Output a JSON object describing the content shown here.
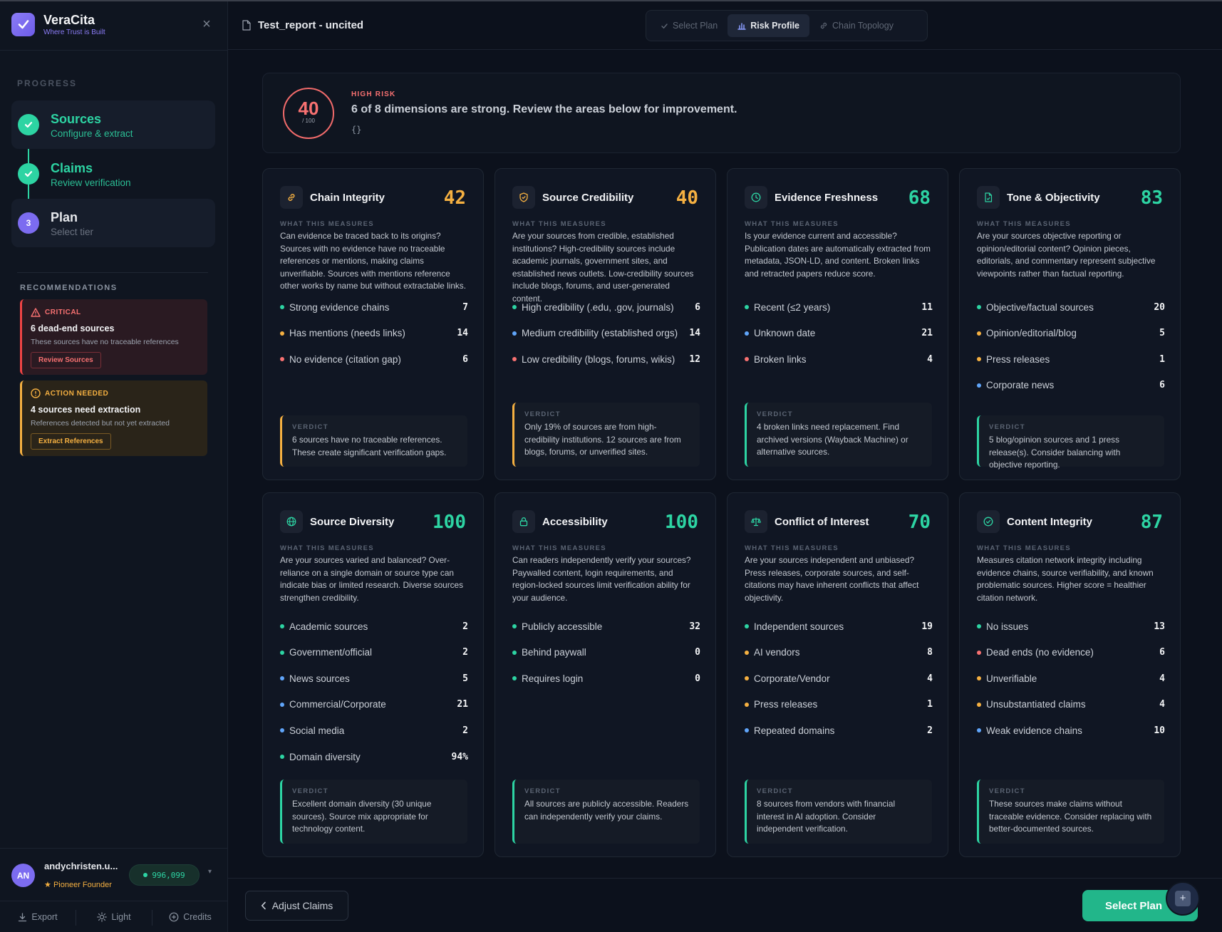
{
  "app": {
    "name": "VeraCita",
    "tagline": "Where Trust is Built"
  },
  "document": {
    "title": "Test_report - uncited"
  },
  "tabs": [
    {
      "label": "Select Plan",
      "icon": "check-icon",
      "active": false
    },
    {
      "label": "Risk Profile",
      "icon": "bar-chart-icon",
      "active": true
    },
    {
      "label": "Chain Topology",
      "icon": "link-icon",
      "active": false
    }
  ],
  "progress": {
    "title": "PROGRESS",
    "steps": [
      {
        "title": "Sources",
        "subtitle": "Configure & extract",
        "status": "done"
      },
      {
        "title": "Claims",
        "subtitle": "Review verification",
        "status": "done"
      },
      {
        "title": "Plan",
        "subtitle": "Select tier",
        "status": "current",
        "number": "3"
      }
    ]
  },
  "recommendations": {
    "title": "RECOMMENDATIONS",
    "items": [
      {
        "level": "CRITICAL",
        "headline": "6 dead-end sources",
        "description": "These sources have no traceable references",
        "action": "Review Sources"
      },
      {
        "level": "ACTION NEEDED",
        "headline": "4 sources need extraction",
        "description": "References detected but not yet extracted",
        "action": "Extract References"
      }
    ]
  },
  "user": {
    "initials": "AN",
    "name": "andychristen.u...",
    "role": "Pioneer Founder",
    "credits": "996,099"
  },
  "footer": {
    "export": "Export",
    "theme": "Light",
    "credits": "Credits"
  },
  "summary": {
    "score": "40",
    "score_max": "/ 100",
    "risk_label": "HIGH RISK",
    "headline": "6 of 8 dimensions are strong. Review the areas below for improvement.",
    "extra": "{}"
  },
  "colors": {
    "green": "#2dd4a3",
    "amber": "#f5b041",
    "red": "#f87171",
    "blue": "#60a5fa"
  },
  "labels": {
    "what_this_measures": "WHAT THIS MEASURES",
    "verdict": "VERDICT"
  },
  "cards": [
    {
      "title": "Chain Integrity",
      "score": "42",
      "score_color": "amber",
      "icon": "chain-link-icon",
      "description": "Can evidence be traced back to its origins? Sources with no evidence have no traceable references or mentions, making claims unverifiable. Sources with mentions reference other works by name but without extractable links.",
      "metrics": [
        {
          "label": "Strong evidence chains",
          "value": "7",
          "dot": "green"
        },
        {
          "label": "Has mentions (needs links)",
          "value": "14",
          "dot": "amber"
        },
        {
          "label": "No evidence (citation gap)",
          "value": "6",
          "dot": "red"
        }
      ],
      "verdict": "6 sources have no traceable references. These create significant verification gaps.",
      "verdict_color": "amber"
    },
    {
      "title": "Source Credibility",
      "score": "40",
      "score_color": "amber",
      "icon": "shield-icon",
      "description": "Are your sources from credible, established institutions? High-credibility sources include academic journals, government sites, and established news outlets. Low-credibility sources include blogs, forums, and user-generated content.",
      "metrics": [
        {
          "label": "High credibility (.edu, .gov, journals)",
          "value": "6",
          "dot": "green"
        },
        {
          "label": "Medium credibility (established orgs)",
          "value": "14",
          "dot": "blue"
        },
        {
          "label": "Low credibility (blogs, forums, wikis)",
          "value": "12",
          "dot": "red"
        }
      ],
      "verdict": "Only 19% of sources are from high-credibility institutions. 12 sources are from blogs, forums, or unverified sites.",
      "verdict_color": "amber"
    },
    {
      "title": "Evidence Freshness",
      "score": "68",
      "score_color": "green",
      "icon": "clock-icon",
      "description": "Is your evidence current and accessible? Publication dates are automatically extracted from metadata, JSON-LD, and content. Broken links and retracted papers reduce score.",
      "metrics": [
        {
          "label": "Recent (≤2 years)",
          "value": "11",
          "dot": "green"
        },
        {
          "label": "Unknown date",
          "value": "21",
          "dot": "blue"
        },
        {
          "label": "Broken links",
          "value": "4",
          "dot": "red"
        }
      ],
      "verdict": "4 broken links need replacement. Find archived versions (Wayback Machine) or alternative sources.",
      "verdict_color": "green"
    },
    {
      "title": "Tone & Objectivity",
      "score": "83",
      "score_color": "green",
      "icon": "document-icon",
      "description": "Are your sources objective reporting or opinion/editorial content? Opinion pieces, editorials, and commentary represent subjective viewpoints rather than factual reporting.",
      "metrics": [
        {
          "label": "Objective/factual sources",
          "value": "20",
          "dot": "green"
        },
        {
          "label": "Opinion/editorial/blog",
          "value": "5",
          "dot": "amber"
        },
        {
          "label": "Press releases",
          "value": "1",
          "dot": "amber"
        },
        {
          "label": "Corporate news",
          "value": "6",
          "dot": "blue"
        }
      ],
      "verdict": "5 blog/opinion sources and 1 press release(s). Consider balancing with objective reporting.",
      "verdict_color": "green"
    },
    {
      "title": "Source Diversity",
      "score": "100",
      "score_color": "green",
      "icon": "globe-icon",
      "description": "Are your sources varied and balanced? Over-reliance on a single domain or source type can indicate bias or limited research. Diverse sources strengthen credibility.",
      "metrics": [
        {
          "label": "Academic sources",
          "value": "2",
          "dot": "green"
        },
        {
          "label": "Government/official",
          "value": "2",
          "dot": "green"
        },
        {
          "label": "News sources",
          "value": "5",
          "dot": "blue"
        },
        {
          "label": "Commercial/Corporate",
          "value": "21",
          "dot": "blue"
        },
        {
          "label": "Social media",
          "value": "2",
          "dot": "blue"
        },
        {
          "label": "Domain diversity",
          "value": "94%",
          "dot": "green"
        }
      ],
      "verdict": "Excellent domain diversity (30 unique sources). Source mix appropriate for technology content.",
      "verdict_color": "green"
    },
    {
      "title": "Accessibility",
      "score": "100",
      "score_color": "green",
      "icon": "lock-icon",
      "description": "Can readers independently verify your sources? Paywalled content, login requirements, and region-locked sources limit verification ability for your audience.",
      "metrics": [
        {
          "label": "Publicly accessible",
          "value": "32",
          "dot": "green"
        },
        {
          "label": "Behind paywall",
          "value": "0",
          "dot": "green"
        },
        {
          "label": "Requires login",
          "value": "0",
          "dot": "green"
        }
      ],
      "verdict": "All sources are publicly accessible. Readers can independently verify your claims.",
      "verdict_color": "green"
    },
    {
      "title": "Conflict of Interest",
      "score": "70",
      "score_color": "green",
      "icon": "scale-icon",
      "description": "Are your sources independent and unbiased? Press releases, corporate sources, and self-citations may have inherent conflicts that affect objectivity.",
      "metrics": [
        {
          "label": "Independent sources",
          "value": "19",
          "dot": "green"
        },
        {
          "label": "AI vendors",
          "value": "8",
          "dot": "amber"
        },
        {
          "label": "Corporate/Vendor",
          "value": "4",
          "dot": "amber"
        },
        {
          "label": "Press releases",
          "value": "1",
          "dot": "amber"
        },
        {
          "label": "Repeated domains",
          "value": "2",
          "dot": "blue"
        }
      ],
      "verdict": "8 sources from vendors with financial interest in AI adoption. Consider independent verification.",
      "verdict_color": "green"
    },
    {
      "title": "Content Integrity",
      "score": "87",
      "score_color": "green",
      "icon": "check-circle-icon",
      "description": "Measures citation network integrity including evidence chains, source verifiability, and known problematic sources. Higher score = healthier citation network.",
      "metrics": [
        {
          "label": "No issues",
          "value": "13",
          "dot": "green"
        },
        {
          "label": "Dead ends (no evidence)",
          "value": "6",
          "dot": "red"
        },
        {
          "label": "Unverifiable",
          "value": "4",
          "dot": "amber"
        },
        {
          "label": "Unsubstantiated claims",
          "value": "4",
          "dot": "amber"
        },
        {
          "label": "Weak evidence chains",
          "value": "10",
          "dot": "blue"
        }
      ],
      "verdict": "These sources make claims without traceable evidence. Consider replacing with better-documented sources.",
      "verdict_color": "green"
    }
  ],
  "actions": {
    "back": "Adjust Claims",
    "next": "Select Plan",
    "fab": "+"
  }
}
